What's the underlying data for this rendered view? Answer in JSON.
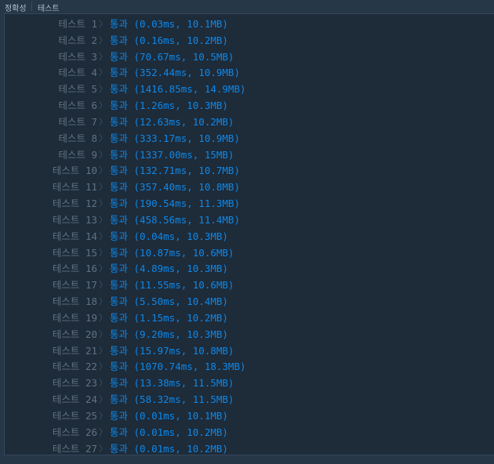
{
  "header": {
    "accuracy_label": "정확성",
    "test_label": "테스트"
  },
  "chevron": "〉",
  "tests": [
    {
      "label": "테스트 1",
      "result": "통과 (0.03ms, 10.1MB)"
    },
    {
      "label": "테스트 2",
      "result": "통과 (0.16ms, 10.2MB)"
    },
    {
      "label": "테스트 3",
      "result": "통과 (70.67ms, 10.5MB)"
    },
    {
      "label": "테스트 4",
      "result": "통과 (352.44ms, 10.9MB)"
    },
    {
      "label": "테스트 5",
      "result": "통과 (1416.85ms, 14.9MB)"
    },
    {
      "label": "테스트 6",
      "result": "통과 (1.26ms, 10.3MB)"
    },
    {
      "label": "테스트 7",
      "result": "통과 (12.63ms, 10.2MB)"
    },
    {
      "label": "테스트 8",
      "result": "통과 (333.17ms, 10.9MB)"
    },
    {
      "label": "테스트 9",
      "result": "통과 (1337.00ms, 15MB)"
    },
    {
      "label": "테스트 10",
      "result": "통과 (132.71ms, 10.7MB)"
    },
    {
      "label": "테스트 11",
      "result": "통과 (357.40ms, 10.8MB)"
    },
    {
      "label": "테스트 12",
      "result": "통과 (190.54ms, 11.3MB)"
    },
    {
      "label": "테스트 13",
      "result": "통과 (458.56ms, 11.4MB)"
    },
    {
      "label": "테스트 14",
      "result": "통과 (0.04ms, 10.3MB)"
    },
    {
      "label": "테스트 15",
      "result": "통과 (10.87ms, 10.6MB)"
    },
    {
      "label": "테스트 16",
      "result": "통과 (4.89ms, 10.3MB)"
    },
    {
      "label": "테스트 17",
      "result": "통과 (11.55ms, 10.6MB)"
    },
    {
      "label": "테스트 18",
      "result": "통과 (5.50ms, 10.4MB)"
    },
    {
      "label": "테스트 19",
      "result": "통과 (1.15ms, 10.2MB)"
    },
    {
      "label": "테스트 20",
      "result": "통과 (9.20ms, 10.3MB)"
    },
    {
      "label": "테스트 21",
      "result": "통과 (15.97ms, 10.8MB)"
    },
    {
      "label": "테스트 22",
      "result": "통과 (1070.74ms, 18.3MB)"
    },
    {
      "label": "테스트 23",
      "result": "통과 (13.38ms, 11.5MB)"
    },
    {
      "label": "테스트 24",
      "result": "통과 (58.32ms, 11.5MB)"
    },
    {
      "label": "테스트 25",
      "result": "통과 (0.01ms, 10.1MB)"
    },
    {
      "label": "테스트 26",
      "result": "통과 (0.01ms, 10.2MB)"
    },
    {
      "label": "테스트 27",
      "result": "통과 (0.01ms, 10.2MB)"
    }
  ],
  "colors": {
    "background": "#263747",
    "panel": "#1e2b39",
    "label": "#5f7283",
    "pass": "#0e88e8"
  }
}
